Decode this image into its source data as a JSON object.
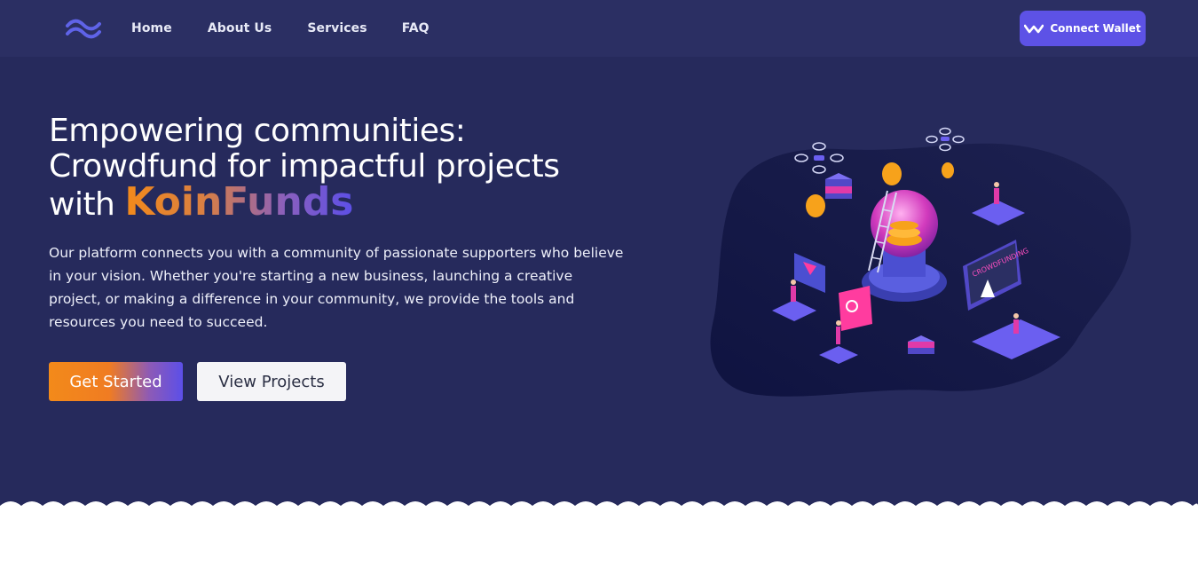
{
  "nav": {
    "logo": "logo-icon",
    "links": [
      "Home",
      "About Us",
      "Services",
      "FAQ"
    ],
    "wallet_button": "Connect Wallet",
    "wallet_icon": "wallet-connect-icon"
  },
  "hero": {
    "headline_line1": "Empowering communities:",
    "headline_line2": "Crowdfund for impactful projects",
    "headline_with": "with",
    "brand": "KoinFunds",
    "description": "Our platform connects you with a community of passionate supporters who believe in your vision. Whether you're starting a new business, launching a creative project, or making a difference in your community, we provide the tools and resources you need to succeed.",
    "primary_button": "Get Started",
    "secondary_button": "View Projects",
    "illustration_caption": "CROWDFUNDING"
  },
  "colors": {
    "hero_bg": "#262a5c",
    "nav_bg": "#2b2f63",
    "accent_purple": "#5d52e6",
    "accent_orange": "#f38a1a",
    "pink": "#e12fa8"
  }
}
